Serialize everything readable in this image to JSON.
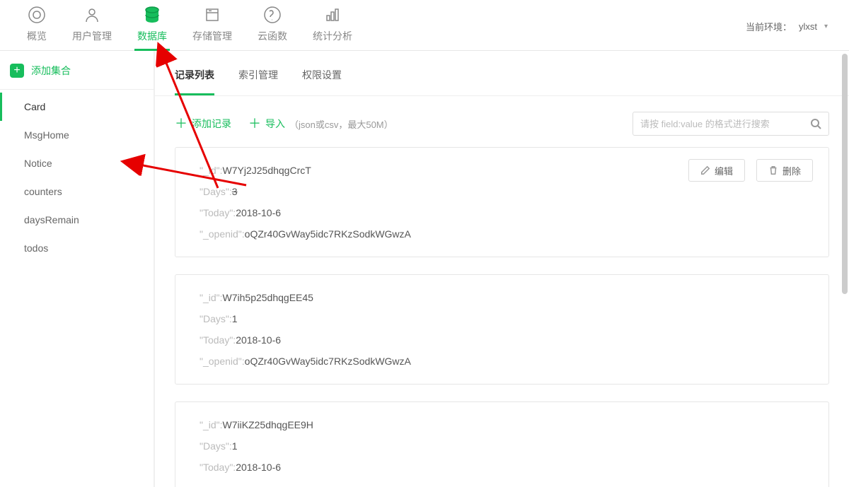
{
  "env": {
    "label": "当前环境：",
    "value": "ylxst"
  },
  "topnav": {
    "active": 2,
    "items": [
      {
        "label": "概览",
        "icon": "overview"
      },
      {
        "label": "用户管理",
        "icon": "users"
      },
      {
        "label": "数据库",
        "icon": "database"
      },
      {
        "label": "存储管理",
        "icon": "storage"
      },
      {
        "label": "云函数",
        "icon": "functions"
      },
      {
        "label": "统计分析",
        "icon": "stats"
      }
    ]
  },
  "sidebar": {
    "add_label": "添加集合",
    "selected": 0,
    "collections": [
      "Card",
      "MsgHome",
      "Notice",
      "counters",
      "daysRemain",
      "todos"
    ]
  },
  "tabs": {
    "active": 0,
    "items": [
      "记录列表",
      "索引管理",
      "权限设置"
    ]
  },
  "toolbar": {
    "add_record": "添加记录",
    "import": "导入",
    "import_hint": "（json或csv，最大50M）",
    "search_placeholder": "请按 field:value 的格式进行搜索"
  },
  "record_actions": {
    "edit": "编辑",
    "delete": "删除"
  },
  "records": [
    {
      "_id": "W7Yj2J25dhqgCrcT",
      "Days": "3",
      "Days_struck": true,
      "Today": "2018-10-6",
      "_openid": "oQZr40GvWay5idc7RKzSodkWGwzA"
    },
    {
      "_id": "W7ih5p25dhqgEE45",
      "Days": "1",
      "Today": "2018-10-6",
      "_openid": "oQZr40GvWay5idc7RKzSodkWGwzA"
    },
    {
      "_id": "W7iiKZ25dhqgEE9H",
      "Days": "1",
      "Today": "2018-10-6"
    }
  ]
}
